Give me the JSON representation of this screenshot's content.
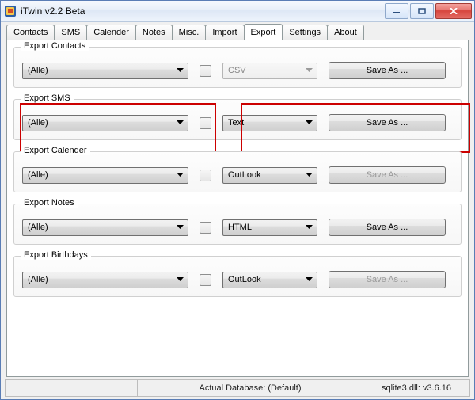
{
  "window": {
    "title": "iTwin v2.2 Beta"
  },
  "tabs": [
    "Contacts",
    "SMS",
    "Calender",
    "Notes",
    "Misc.",
    "Import",
    "Export",
    "Settings",
    "About"
  ],
  "active_tab_index": 6,
  "groups": [
    {
      "title": "Export Contacts",
      "filter_value": "(Alle)",
      "format_value": "CSV",
      "format_disabled": true,
      "save_label": "Save As ...",
      "save_disabled": false,
      "highlight": false
    },
    {
      "title": "Export SMS",
      "filter_value": "(Alle)",
      "format_value": "Text",
      "format_disabled": false,
      "save_label": "Save As ...",
      "save_disabled": false,
      "highlight": true
    },
    {
      "title": "Export Calender",
      "filter_value": "(Alle)",
      "format_value": "OutLook",
      "format_disabled": false,
      "save_label": "Save As ...",
      "save_disabled": true,
      "highlight": false
    },
    {
      "title": "Export Notes",
      "filter_value": "(Alle)",
      "format_value": "HTML",
      "format_disabled": false,
      "save_label": "Save As ...",
      "save_disabled": false,
      "highlight": false
    },
    {
      "title": "Export Birthdays",
      "filter_value": "(Alle)",
      "format_value": "OutLook",
      "format_disabled": false,
      "save_label": "Save As ...",
      "save_disabled": true,
      "highlight": false
    }
  ],
  "statusbar": {
    "left": "",
    "mid": "Actual Database: (Default)",
    "right": "sqlite3.dll: v3.6.16"
  }
}
